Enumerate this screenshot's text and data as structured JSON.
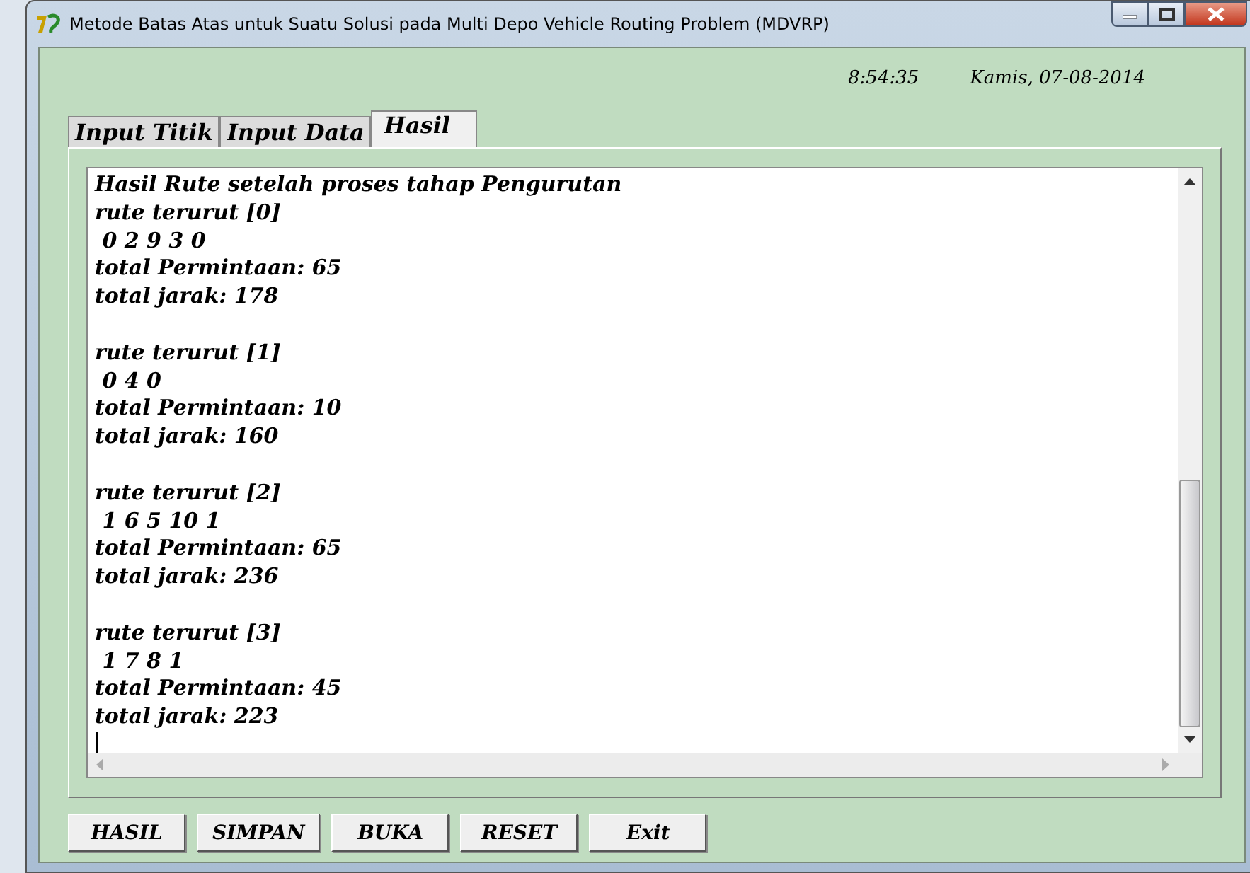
{
  "window": {
    "title": "Metode Batas Atas untuk Suatu Solusi pada Multi Depo Vehicle Routing Problem (MDVRP)"
  },
  "clock": {
    "time": "8:54:35",
    "date": "Kamis, 07-08-2014"
  },
  "tabs": [
    {
      "label": "Input Titik",
      "selected": false
    },
    {
      "label": "Input Data",
      "selected": false
    },
    {
      "label": "Hasil",
      "selected": true
    }
  ],
  "output": {
    "heading": "Hasil Rute setelah proses tahap Pengurutan",
    "routes": [
      {
        "title": "rute terurut [0]",
        "sequence": " 0 2 9 3 0",
        "demand": "total Permintaan: 65",
        "distance": "total jarak: 178"
      },
      {
        "title": "rute terurut [1]",
        "sequence": " 0 4 0",
        "demand": "total Permintaan: 10",
        "distance": "total jarak: 160"
      },
      {
        "title": "rute terurut [2]",
        "sequence": " 1 6 5 10 1",
        "demand": "total Permintaan: 65",
        "distance": "total jarak: 236"
      },
      {
        "title": "rute terurut [3]",
        "sequence": " 1 7 8 1",
        "demand": "total Permintaan: 45",
        "distance": "total jarak: 223"
      }
    ]
  },
  "buttons": [
    "HASIL",
    "SIMPAN",
    "BUKA",
    "RESET",
    "Exit"
  ]
}
